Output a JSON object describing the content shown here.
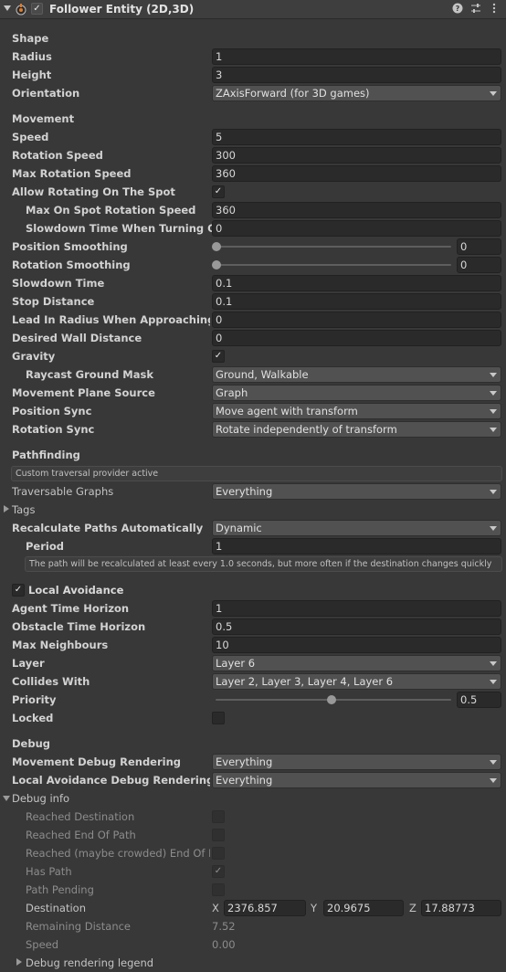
{
  "header": {
    "title": "Follower Entity (2D,3D)",
    "enabled": true,
    "icons": [
      "script-icon",
      "help-icon",
      "presets-icon",
      "more-icon"
    ]
  },
  "shape": {
    "section": "Shape",
    "radius_label": "Radius",
    "radius": "1",
    "height_label": "Height",
    "height": "3",
    "orientation_label": "Orientation",
    "orientation": "ZAxisForward (for 3D games)"
  },
  "movement": {
    "section": "Movement",
    "speed_label": "Speed",
    "speed": "5",
    "rotation_speed_label": "Rotation Speed",
    "rotation_speed": "300",
    "max_rotation_speed_label": "Max Rotation Speed",
    "max_rotation_speed": "360",
    "allow_rotating_label": "Allow Rotating On The Spot",
    "allow_rotating": true,
    "max_on_spot_label": "Max On Spot Rotation Speed",
    "max_on_spot": "360",
    "slowdown_turning_label": "Slowdown Time When Turning On Spot",
    "slowdown_turning": "0",
    "position_smoothing_label": "Position Smoothing",
    "position_smoothing": "0",
    "rotation_smoothing_label": "Rotation Smoothing",
    "rotation_smoothing": "0",
    "slowdown_time_label": "Slowdown Time",
    "slowdown_time": "0.1",
    "stop_distance_label": "Stop Distance",
    "stop_distance": "0.1",
    "lead_in_label": "Lead In Radius When Approaching Destination",
    "lead_in": "0",
    "desired_wall_label": "Desired Wall Distance",
    "desired_wall": "0",
    "gravity_label": "Gravity",
    "gravity": true,
    "raycast_label": "Raycast Ground Mask",
    "raycast": "Ground, Walkable",
    "plane_source_label": "Movement Plane Source",
    "plane_source": "Graph",
    "position_sync_label": "Position Sync",
    "position_sync": "Move agent with transform",
    "rotation_sync_label": "Rotation Sync",
    "rotation_sync": "Rotate independently of transform"
  },
  "pathfinding": {
    "section": "Pathfinding",
    "info": "Custom traversal provider active",
    "graphs_label": "Traversable Graphs",
    "graphs": "Everything",
    "tags_label": "Tags",
    "recalc_label": "Recalculate Paths Automatically",
    "recalc": "Dynamic",
    "period_label": "Period",
    "period": "1",
    "period_help": "The path will be recalculated at least every 1.0 seconds, but more often if the destination changes quickly"
  },
  "avoidance": {
    "label": "Local Avoidance",
    "enabled": true,
    "agent_horizon_label": "Agent Time Horizon",
    "agent_horizon": "1",
    "obstacle_horizon_label": "Obstacle Time Horizon",
    "obstacle_horizon": "0.5",
    "max_neighbours_label": "Max Neighbours",
    "max_neighbours": "10",
    "layer_label": "Layer",
    "layer": "Layer 6",
    "collides_label": "Collides With",
    "collides": "Layer 2, Layer 3, Layer 4, Layer 6",
    "priority_label": "Priority",
    "priority": "0.5",
    "locked_label": "Locked",
    "locked": false
  },
  "debug": {
    "section": "Debug",
    "movement_render_label": "Movement Debug Rendering",
    "movement_render": "Everything",
    "avoidance_render_label": "Local Avoidance Debug Rendering",
    "avoidance_render": "Everything",
    "info_label": "Debug info",
    "reached_dest_label": "Reached Destination",
    "reached_dest": false,
    "reached_end_label": "Reached End Of Path",
    "reached_end": false,
    "reached_crowded_label": "Reached (maybe crowded) End Of Path",
    "reached_crowded": false,
    "has_path_label": "Has Path",
    "has_path": true,
    "path_pending_label": "Path Pending",
    "path_pending": false,
    "destination_label": "Destination",
    "dest_x_label": "X",
    "dest_x": "2376.857",
    "dest_y_label": "Y",
    "dest_y": "20.9675",
    "dest_z_label": "Z",
    "dest_z": "17.88773",
    "remaining_label": "Remaining Distance",
    "remaining": "7.52",
    "speed_label": "Speed",
    "speed": "0.00",
    "legend_label": "Debug rendering legend"
  }
}
